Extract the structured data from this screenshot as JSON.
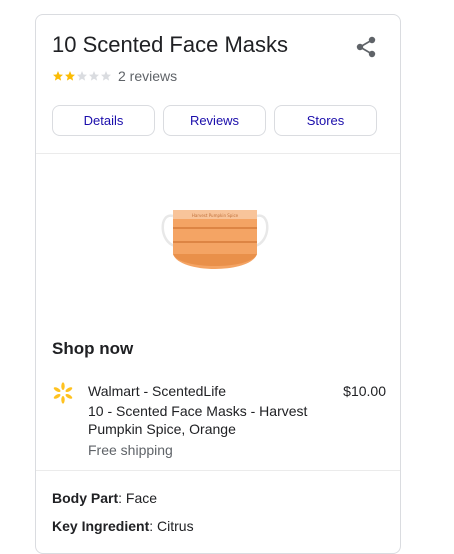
{
  "product": {
    "title": "10 Scented Face Masks",
    "rating": 2,
    "rating_max": 5,
    "reviews_label": "2 reviews"
  },
  "tabs": [
    {
      "label": "Details"
    },
    {
      "label": "Reviews"
    },
    {
      "label": "Stores"
    }
  ],
  "shop": {
    "heading": "Shop now",
    "offer": {
      "store": "Walmart - ScentedLife",
      "price": "$10.00",
      "title": "10 - Scented Face Masks - Harvest Pumpkin Spice, Orange",
      "shipping": "Free shipping"
    }
  },
  "attributes": [
    {
      "label": "Body Part",
      "value": "Face"
    },
    {
      "label": "Key Ingredient",
      "value": "Citrus"
    }
  ],
  "colors": {
    "link": "#1a0dab",
    "star_filled": "#fbbc04",
    "star_empty": "#dadce0",
    "walmart": "#ffc220",
    "mask": "#f0a060"
  },
  "icons": {
    "share": "share-icon",
    "store": "walmart-spark-icon"
  }
}
